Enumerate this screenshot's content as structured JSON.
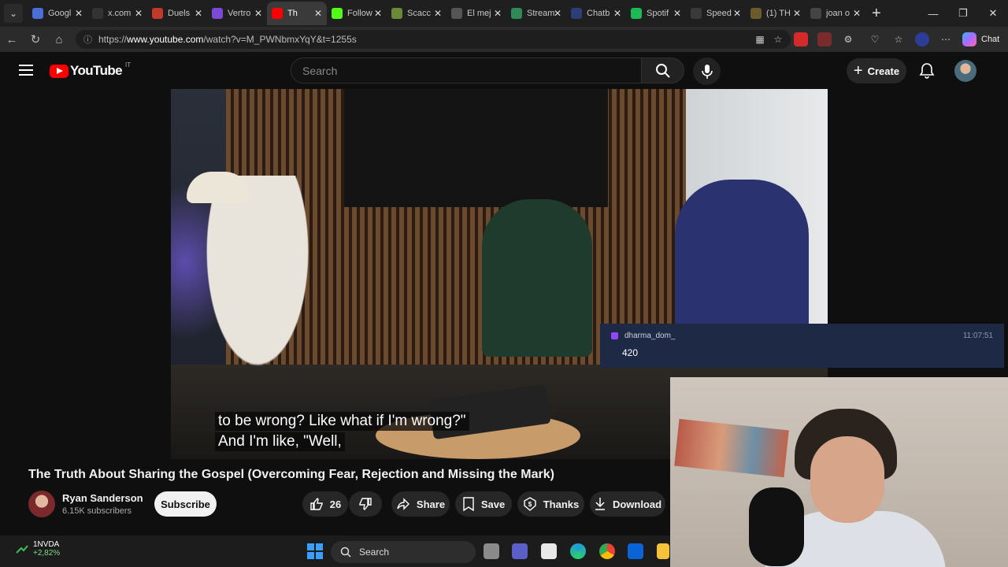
{
  "browser": {
    "tabs": [
      {
        "title": "Googl",
        "color": "#4a6fd6"
      },
      {
        "title": "x.com",
        "color": "#333333"
      },
      {
        "title": "Duels",
        "color": "#c0392b"
      },
      {
        "title": "Vertro",
        "color": "#7b4bd6"
      },
      {
        "title": "Th",
        "color": "#ff0000",
        "active": true
      },
      {
        "title": "Follow",
        "color": "#53fc18"
      },
      {
        "title": "Scacc",
        "color": "#6a8a3a"
      },
      {
        "title": "El mej",
        "color": "#555555"
      },
      {
        "title": "Stream",
        "color": "#2e8b57"
      },
      {
        "title": "Chatb",
        "color": "#2c3e77"
      },
      {
        "title": "Spotif",
        "color": "#1db954"
      },
      {
        "title": "Speed",
        "color": "#3a3a3a"
      },
      {
        "title": "(1) TH",
        "color": "#6b5b2a"
      },
      {
        "title": "joan o",
        "color": "#444444"
      }
    ],
    "url_prefix": "https://",
    "url_host": "www.youtube.com",
    "url_path": "/watch?v=M_PWNbmxYqY&t=1255s",
    "chat_label": "Chat"
  },
  "youtube": {
    "logo_text": "YouTube",
    "region": "IT",
    "search_placeholder": "Search",
    "create_label": "Create"
  },
  "video": {
    "caption_line1": "to be wrong? Like what if I'm wrong?\"",
    "caption_line2": "And I'm like, \"Well,",
    "title": "The Truth About Sharing the Gospel (Overcoming Fear, Rejection and Missing the Mark)",
    "channel": "Ryan Sanderson",
    "subscribers": "6.15K subscribers",
    "subscribe_label": "Subscribe",
    "likes": "26",
    "share_label": "Share",
    "save_label": "Save",
    "thanks_label": "Thanks",
    "download_label": "Download"
  },
  "chat_overlay": {
    "username": "dharma_dom_",
    "time": "11:07:51",
    "message": "420"
  },
  "taskbar": {
    "stock_name": "1NVDA",
    "stock_change": "+2,82%",
    "search_label": "Search"
  }
}
